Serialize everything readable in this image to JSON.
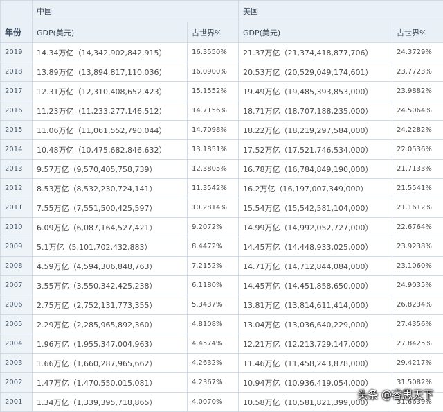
{
  "header": {
    "year": "年份",
    "china": "中国",
    "usa": "美国",
    "gdp": "GDP(美元)",
    "share": "占世界%"
  },
  "rows": [
    {
      "year": "2019",
      "cn_gdp": "14.34万亿（14,342,902,842,915）",
      "cn_share": "16.3550%",
      "us_gdp": "21.37万亿（21,374,418,877,706）",
      "us_share": "24.3729%"
    },
    {
      "year": "2018",
      "cn_gdp": "13.89万亿（13,894,817,110,036）",
      "cn_share": "16.0900%",
      "us_gdp": "20.53万亿（20,529,049,174,601）",
      "us_share": "23.7723%"
    },
    {
      "year": "2017",
      "cn_gdp": "12.31万亿（12,310,408,652,423）",
      "cn_share": "15.1552%",
      "us_gdp": "19.49万亿（19,485,393,853,000）",
      "us_share": "23.9882%"
    },
    {
      "year": "2016",
      "cn_gdp": "11.23万亿（11,233,277,146,512）",
      "cn_share": "14.7156%",
      "us_gdp": "18.71万亿（18,707,188,235,000）",
      "us_share": "24.5064%"
    },
    {
      "year": "2015",
      "cn_gdp": "11.06万亿（11,061,552,790,044）",
      "cn_share": "14.7098%",
      "us_gdp": "18.22万亿（18,219,297,584,000）",
      "us_share": "24.2282%"
    },
    {
      "year": "2014",
      "cn_gdp": "10.48万亿（10,475,682,846,632）",
      "cn_share": "13.1851%",
      "us_gdp": "17.52万亿（17,521,746,534,000）",
      "us_share": "22.0536%"
    },
    {
      "year": "2013",
      "cn_gdp": "9.57万亿（9,570,405,758,739）",
      "cn_share": "12.3805%",
      "us_gdp": "16.78万亿（16,784,849,190,000）",
      "us_share": "21.7133%"
    },
    {
      "year": "2012",
      "cn_gdp": "8.53万亿（8,532,230,724,141）",
      "cn_share": "11.3542%",
      "us_gdp": "16.2万亿（16,197,007,349,000）",
      "us_share": "21.5541%"
    },
    {
      "year": "2011",
      "cn_gdp": "7.55万亿（7,551,500,425,597）",
      "cn_share": "10.2814%",
      "us_gdp": "15.54万亿（15,542,581,104,000）",
      "us_share": "21.1612%"
    },
    {
      "year": "2010",
      "cn_gdp": "6.09万亿（6,087,164,527,421）",
      "cn_share": "9.2072%",
      "us_gdp": "14.99万亿（14,992,052,727,000）",
      "us_share": "22.6764%"
    },
    {
      "year": "2009",
      "cn_gdp": "5.1万亿（5,101,702,432,883）",
      "cn_share": "8.4472%",
      "us_gdp": "14.45万亿（14,448,933,025,000）",
      "us_share": "23.9238%"
    },
    {
      "year": "2008",
      "cn_gdp": "4.59万亿（4,594,306,848,763）",
      "cn_share": "7.2152%",
      "us_gdp": "14.71万亿（14,712,844,084,000）",
      "us_share": "23.1060%"
    },
    {
      "year": "2007",
      "cn_gdp": "3.55万亿（3,550,342,425,238）",
      "cn_share": "6.1180%",
      "us_gdp": "14.45万亿（14,451,858,650,000）",
      "us_share": "24.9035%"
    },
    {
      "year": "2006",
      "cn_gdp": "2.75万亿（2,752,131,773,355）",
      "cn_share": "5.3437%",
      "us_gdp": "13.81万亿（13,814,611,414,000）",
      "us_share": "26.8234%"
    },
    {
      "year": "2005",
      "cn_gdp": "2.29万亿（2,285,965,892,360）",
      "cn_share": "4.8108%",
      "us_gdp": "13.04万亿（13,036,640,229,000）",
      "us_share": "27.4356%"
    },
    {
      "year": "2004",
      "cn_gdp": "1.96万亿（1,955,347,004,963）",
      "cn_share": "4.4574%",
      "us_gdp": "12.21万亿（12,213,729,147,000）",
      "us_share": "27.8425%"
    },
    {
      "year": "2003",
      "cn_gdp": "1.66万亿（1,660,287,965,662）",
      "cn_share": "4.2632%",
      "us_gdp": "11.46万亿（11,458,243,878,000）",
      "us_share": "29.4217%"
    },
    {
      "year": "2002",
      "cn_gdp": "1.47万亿（1,470,550,015,081）",
      "cn_share": "4.2367%",
      "us_gdp": "10.94万亿（10,936,419,054,000）",
      "us_share": "31.5082%"
    },
    {
      "year": "2001",
      "cn_gdp": "1.34万亿（1,339,395,718,865）",
      "cn_share": "4.0070%",
      "us_gdp": "10.58万亿（10,581,821,399,000）",
      "us_share": "31.6639%"
    }
  ],
  "watermark": "头条 @睿思天下"
}
